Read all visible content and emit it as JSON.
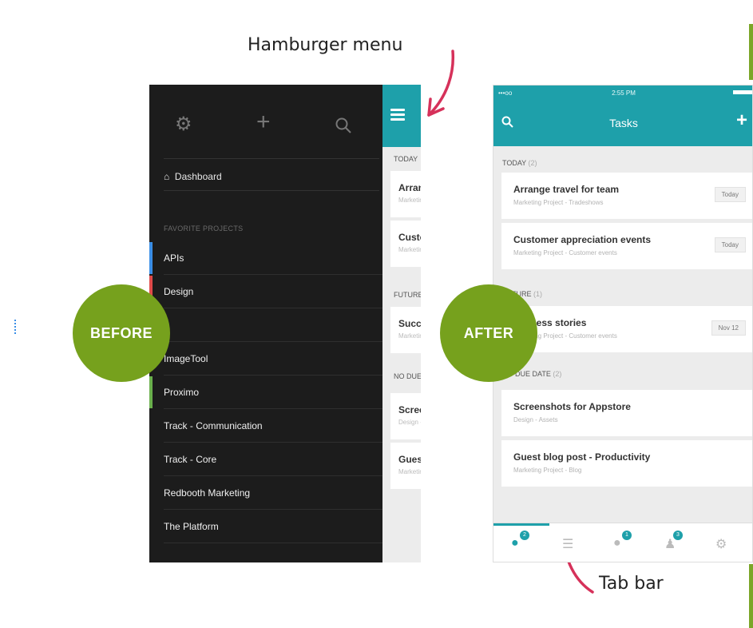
{
  "annotations": {
    "hamburger_label": "Hamburger menu",
    "tabbar_label": "Tab bar"
  },
  "colors": {
    "teal": "#1ea0aa",
    "green_badge": "#76a11d",
    "arrow": "#d6315a",
    "sidebar_bg": "#1c1c1c"
  },
  "before": {
    "badge_label": "BEFORE",
    "top_icons": [
      "gear-icon",
      "plus-icon",
      "search-icon"
    ],
    "dashboard_label": "Dashboard",
    "favorite_projects_heading": "FAVORITE PROJECTS",
    "projects": [
      {
        "label": "APIs",
        "color": "#3a8ee6"
      },
      {
        "label": "Design",
        "color": "#e04a4a"
      },
      {
        "label": "",
        "color": ""
      },
      {
        "label": "ImageTool",
        "color": ""
      },
      {
        "label": "Proximo",
        "color": "#6ab04c"
      },
      {
        "label": "Track - Communication",
        "color": ""
      },
      {
        "label": "Track - Core",
        "color": ""
      },
      {
        "label": "Redbooth Marketing",
        "color": ""
      },
      {
        "label": "The Platform",
        "color": ""
      }
    ],
    "panel": {
      "sections": [
        "TODAY",
        "FUTURE",
        "NO DUE DATE"
      ],
      "cards": [
        {
          "title": "Arrange travel for team",
          "sub": "Marketing Project - Tradeshows"
        },
        {
          "title": "Customer appreciation events",
          "sub": "Marketing Project - Customer events"
        },
        {
          "title": "Success stories",
          "sub": "Marketing Project - Customer events"
        },
        {
          "title": "Screenshots for Appstore",
          "sub": "Design - Assets"
        },
        {
          "title": "Guest blog post - Productivity",
          "sub": "Marketing Project - Blog"
        }
      ]
    }
  },
  "after": {
    "badge_label": "AFTER",
    "status": {
      "carrier": "•••oo",
      "time": "2:55 PM"
    },
    "title": "Tasks",
    "sections": [
      {
        "name": "TODAY",
        "count": "(2)"
      },
      {
        "name": "FUTURE",
        "count": "(1)"
      },
      {
        "name": "NO DUE DATE",
        "count": "(2)"
      }
    ],
    "tasks": [
      {
        "title": "Arrange travel for team",
        "sub": "Marketing Project - Tradeshows",
        "badge": "Today"
      },
      {
        "title": "Customer appreciation events",
        "sub": "Marketing Project - Customer events",
        "badge": "Today"
      },
      {
        "title": "Success stories",
        "sub": "Marketing Project - Customer events",
        "badge": "Nov 12"
      },
      {
        "title": "Screenshots for Appstore",
        "sub": "Design - Assets",
        "badge": ""
      },
      {
        "title": "Guest blog post - Productivity",
        "sub": "Marketing Project - Blog",
        "badge": ""
      }
    ],
    "tabs": [
      {
        "icon": "tasks-icon",
        "count": "2"
      },
      {
        "icon": "list-icon",
        "count": ""
      },
      {
        "icon": "conversations-icon",
        "count": "1"
      },
      {
        "icon": "notifications-icon",
        "count": "3"
      },
      {
        "icon": "settings-icon",
        "count": ""
      }
    ]
  }
}
